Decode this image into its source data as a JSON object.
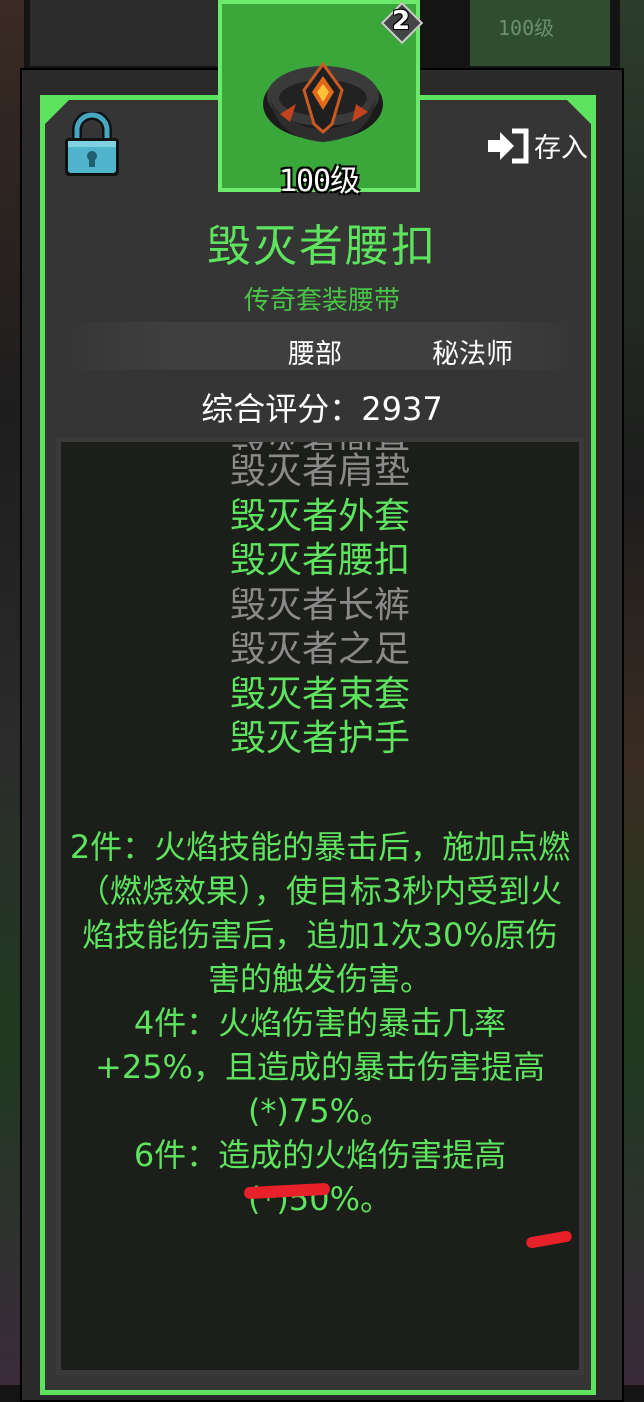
{
  "background": {
    "top_right_label": "100级"
  },
  "item": {
    "level": "100级",
    "count": "2",
    "name": "毁灭者腰扣",
    "type": "传奇套装腰带",
    "slot": "腰部",
    "class": "秘法师",
    "score": "综合评分：2937"
  },
  "actions": {
    "deposit_label": "存入"
  },
  "set": {
    "items": [
      {
        "label": "毁灭者面具",
        "active": false
      },
      {
        "label": "毁灭者肩垫",
        "active": false
      },
      {
        "label": "毁灭者外套",
        "active": true
      },
      {
        "label": "毁灭者腰扣",
        "active": true
      },
      {
        "label": "毁灭者长裤",
        "active": false
      },
      {
        "label": "毁灭者之足",
        "active": false
      },
      {
        "label": "毁灭者束套",
        "active": true
      },
      {
        "label": "毁灭者护手",
        "active": true
      }
    ],
    "bonuses": [
      "2件：火焰技能的暴击后，施加点燃（燃烧效果），使目标3秒内受到火焰技能伤害后，追加1次30%原伤害的触发伤害。",
      "4件：火焰伤害的暴击几率+25%，且造成的暴击伤害提高(*)75%。",
      "6件：造成的火焰伤害提高(*)50%。"
    ]
  },
  "colors": {
    "accent_green": "#5de35d",
    "inactive_gray": "#8a8a8a",
    "annotation_red": "#e8202a"
  }
}
